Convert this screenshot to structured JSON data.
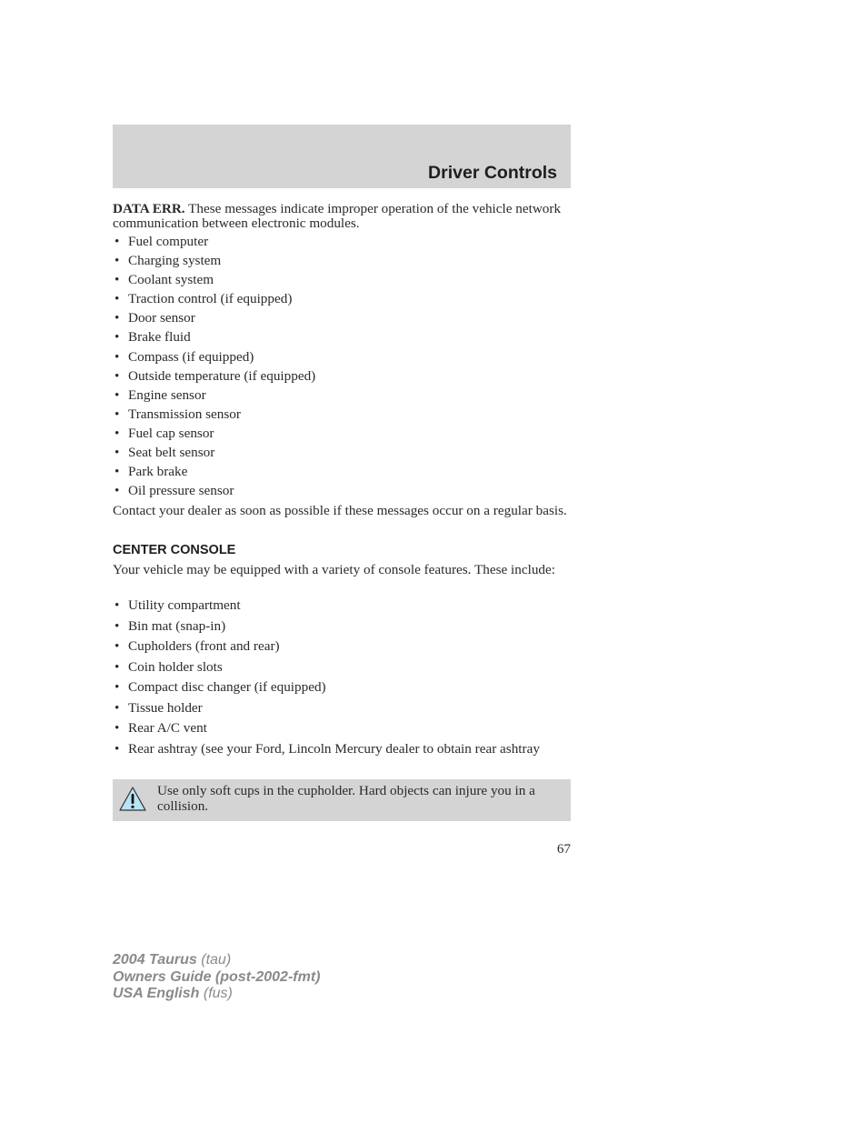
{
  "header": {
    "title": "Driver Controls"
  },
  "data_err": {
    "lead": "DATA ERR.",
    "text": " These messages indicate improper operation of the vehicle network communication between electronic modules.",
    "items": [
      "Fuel computer",
      "Charging system",
      "Coolant system",
      "Traction control (if equipped)",
      "Door sensor",
      "Brake fluid",
      "Compass (if equipped)",
      "Outside temperature (if equipped)",
      "Engine sensor",
      "Transmission sensor",
      "Fuel cap sensor",
      "Seat belt sensor",
      "Park brake",
      "Oil pressure sensor"
    ],
    "closing": "Contact your dealer as soon as possible if these messages occur on a regular basis."
  },
  "center_console": {
    "heading": "CENTER CONSOLE",
    "intro": "Your vehicle may be equipped with a variety of console features. These include:",
    "items": [
      "Utility compartment",
      "Bin mat (snap-in)",
      "Cupholders (front and rear)",
      "Coin holder slots",
      "Compact disc changer (if equipped)",
      "Tissue holder",
      "Rear A/C vent",
      "Rear ashtray (see your Ford, Lincoln Mercury dealer to obtain rear ashtray"
    ]
  },
  "warning": {
    "icon": "warning-triangle-icon",
    "text": "Use only soft cups in the cupholder. Hard objects can injure you in a collision.",
    "icon_fill": "#b8e4f5"
  },
  "page_number": "67",
  "bullet_glyph": "•",
  "footer": {
    "line1_bold": "2004 Taurus",
    "line1_italic": " (tau)",
    "line2_bold": "Owners Guide (post-2002-fmt)",
    "line3_bold": "USA English",
    "line3_italic": " (fus)"
  }
}
